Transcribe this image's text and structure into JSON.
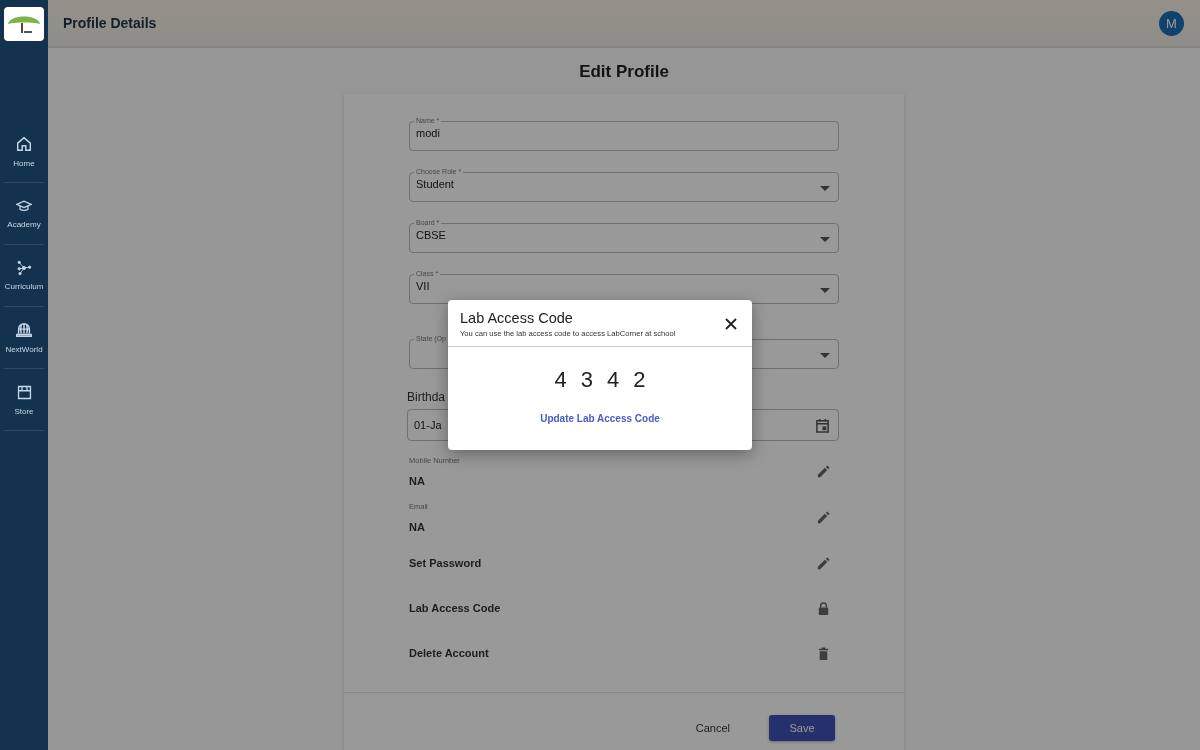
{
  "header": {
    "title": "Profile Details",
    "avatar": "M"
  },
  "sidebar": {
    "items": [
      {
        "label": "Home",
        "kind": "home"
      },
      {
        "label": "Academy",
        "kind": "academy"
      },
      {
        "label": "Curriculum",
        "kind": "curriculum"
      },
      {
        "label": "NextWorld",
        "kind": "nextworld"
      },
      {
        "label": "Store",
        "kind": "store"
      }
    ]
  },
  "form": {
    "title": "Edit Profile",
    "fields": [
      {
        "label": "Name *",
        "value": "modi",
        "kind": "text"
      },
      {
        "label": "Choose Role *",
        "value": "Student",
        "kind": "select"
      },
      {
        "label": "Board *",
        "value": "CBSE",
        "kind": "select"
      },
      {
        "label": "Class *",
        "value": "VII",
        "kind": "select"
      },
      {
        "label": "State (Op",
        "kind": "select"
      }
    ],
    "birthday": {
      "label": "Birthda",
      "value": "01-Ja"
    },
    "rows": [
      {
        "label": "Mobile Number",
        "value": "NA",
        "kind": "edit"
      },
      {
        "label": "Email",
        "value": "NA",
        "kind": "edit"
      },
      {
        "value": "Set Password",
        "kind": "edit"
      },
      {
        "value": "Lab Access Code",
        "kind": "lock"
      },
      {
        "value": "Delete Account",
        "kind": "delete"
      }
    ],
    "cancel": "Cancel",
    "save": "Save"
  },
  "dialog": {
    "title": "Lab Access Code",
    "subtitle": "You can use the lab access code to access LabCorner at school",
    "code": [
      "4",
      "3",
      "4",
      "2"
    ],
    "link": "Update Lab Access Code"
  }
}
